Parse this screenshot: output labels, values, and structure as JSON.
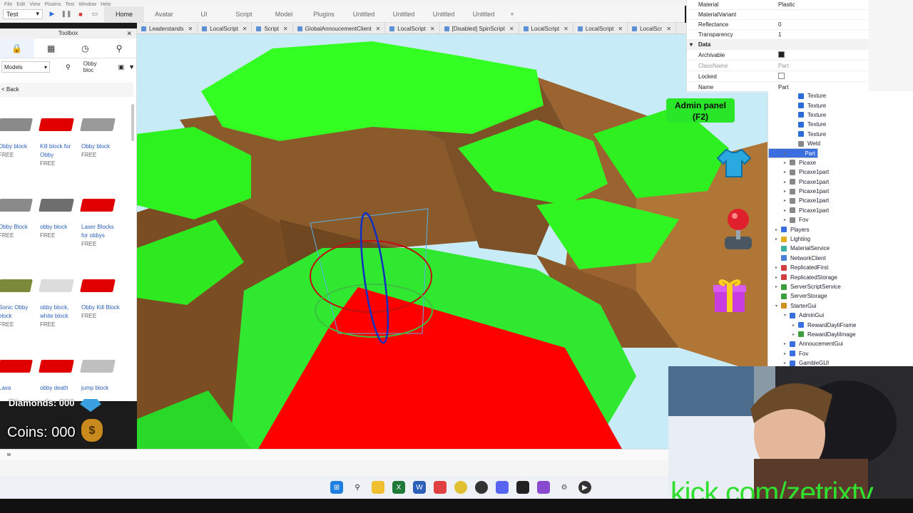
{
  "menubar": [
    "File",
    "Edit",
    "View",
    "Plugins",
    "Test",
    "Window",
    "Help"
  ],
  "ribbon": {
    "mode_select": "Test",
    "tabs": [
      "Home",
      "Avatar",
      "UI",
      "Script",
      "Model",
      "Plugins",
      "Untitled",
      "Untitled",
      "Untitled",
      "Untitled",
      "+"
    ],
    "active_tab": "Home"
  },
  "doc_tabs": [
    "Leaderstands",
    "LocalScript",
    "Script",
    "GlobalAnnoucementClient",
    "LocalScript",
    "[Disabled] SpinScript",
    "LocalScript",
    "LocalScript",
    "LocalScr"
  ],
  "toolbox": {
    "title": "Toolbox",
    "category": "Models",
    "search": "Obby bloc",
    "back": "< Back",
    "assets": [
      {
        "name": "Obby block",
        "price": "FREE",
        "color": "#8a8a8a"
      },
      {
        "name": "Kill block for Obby",
        "price": "FREE",
        "color": "#e00000"
      },
      {
        "name": "Obby block",
        "price": "FREE",
        "color": "#9a9a9a"
      },
      {
        "name": "Obby Block",
        "price": "FREE",
        "color": "#8a8a8a"
      },
      {
        "name": "obby block",
        "price": "FREE",
        "color": "#6e6e6e"
      },
      {
        "name": "Laser Blocks for obbys",
        "price": "FREE",
        "color": "#e00000"
      },
      {
        "name": "Sonic Obby block",
        "price": "FREE",
        "color": "#7a8a3a"
      },
      {
        "name": "obby block, white block",
        "price": "FREE",
        "color": "#dcdcdc"
      },
      {
        "name": "Obby Kill Block",
        "price": "FREE",
        "color": "#e00000"
      },
      {
        "name": "Lava",
        "price": "",
        "color": "#e00000"
      },
      {
        "name": "obby death",
        "price": "",
        "color": "#e00000"
      },
      {
        "name": "jump block",
        "price": "",
        "color": "#bfbfbf"
      }
    ]
  },
  "properties": {
    "rows": [
      {
        "key": "Material",
        "value": "Plastic"
      },
      {
        "key": "MaterialVariant",
        "value": ""
      },
      {
        "key": "Reflectance",
        "value": "0"
      },
      {
        "key": "Transparency",
        "value": "1"
      }
    ],
    "section": "Data",
    "data_rows": [
      {
        "key": "Archivable",
        "value": "checked"
      },
      {
        "key": "ClassName",
        "value": "Part"
      },
      {
        "key": "Locked",
        "value": "unchecked"
      },
      {
        "key": "Name",
        "value": "Part"
      }
    ]
  },
  "explorer": [
    {
      "label": "Texture",
      "indent": 2,
      "icon": "#2b6cd6"
    },
    {
      "label": "Texture",
      "indent": 2,
      "icon": "#2b6cd6"
    },
    {
      "label": "Texture",
      "indent": 2,
      "icon": "#2b6cd6"
    },
    {
      "label": "Texture",
      "indent": 2,
      "icon": "#2b6cd6"
    },
    {
      "label": "Texture",
      "indent": 2,
      "icon": "#2b6cd6"
    },
    {
      "label": "Weld",
      "indent": 2,
      "icon": "#888888"
    },
    {
      "label": "Part",
      "indent": 1,
      "icon": "#3b6fe0",
      "selected": true
    },
    {
      "label": "Picaxe",
      "indent": 1,
      "icon": "#888888"
    },
    {
      "label": "Picaxe1part",
      "indent": 1,
      "icon": "#888888"
    },
    {
      "label": "Picaxe1part",
      "indent": 1,
      "icon": "#888888"
    },
    {
      "label": "Picaxe1part",
      "indent": 1,
      "icon": "#888888"
    },
    {
      "label": "Picaxe1part",
      "indent": 1,
      "icon": "#888888"
    },
    {
      "label": "Picaxe1part",
      "indent": 1,
      "icon": "#888888"
    },
    {
      "label": "Fov",
      "indent": 1,
      "icon": "#888888"
    },
    {
      "label": "Players",
      "indent": 0,
      "icon": "#3b6fe0"
    },
    {
      "label": "Lighting",
      "indent": 0,
      "icon": "#e0b020"
    },
    {
      "label": "MaterialService",
      "indent": 0,
      "icon": "#3bb0a0"
    },
    {
      "label": "NetworkClient",
      "indent": 0,
      "icon": "#4a7fd6"
    },
    {
      "label": "ReplicatedFirst",
      "indent": 0,
      "icon": "#d04040"
    },
    {
      "label": "ReplicatedStorage",
      "indent": 0,
      "icon": "#d04040"
    },
    {
      "label": "ServerScriptService",
      "indent": 0,
      "icon": "#3b9d3b"
    },
    {
      "label": "ServerStorage",
      "indent": 0,
      "icon": "#3b9d3b"
    },
    {
      "label": "StarterGui",
      "indent": 0,
      "icon": "#d09020"
    },
    {
      "label": "AdminGui",
      "indent": 1,
      "icon": "#3b6fe0"
    },
    {
      "label": "RewardDayliFrame",
      "indent": 2,
      "icon": "#3b6fe0"
    },
    {
      "label": "RewardDayliImage",
      "indent": 2,
      "icon": "#3b9d3b"
    },
    {
      "label": "AnnoucementGui",
      "indent": 1,
      "icon": "#3b6fe0"
    },
    {
      "label": "Fov",
      "indent": 1,
      "icon": "#3b6fe0"
    },
    {
      "label": "GambleGUI",
      "indent": 1,
      "icon": "#3b6fe0"
    }
  ],
  "game_hud": {
    "admin_panel": "Admin panel",
    "admin_key": "(F2)",
    "diamonds": "Diamonds: 000",
    "coins": "Coins: 000"
  },
  "command_bar": "w",
  "watermark": "kick.com/zetrixtv",
  "colors": {
    "grass": "#2cf22c",
    "rock": "#8a5a2c",
    "kill_block": "#ff0000",
    "selection": "#3b6fe0"
  }
}
